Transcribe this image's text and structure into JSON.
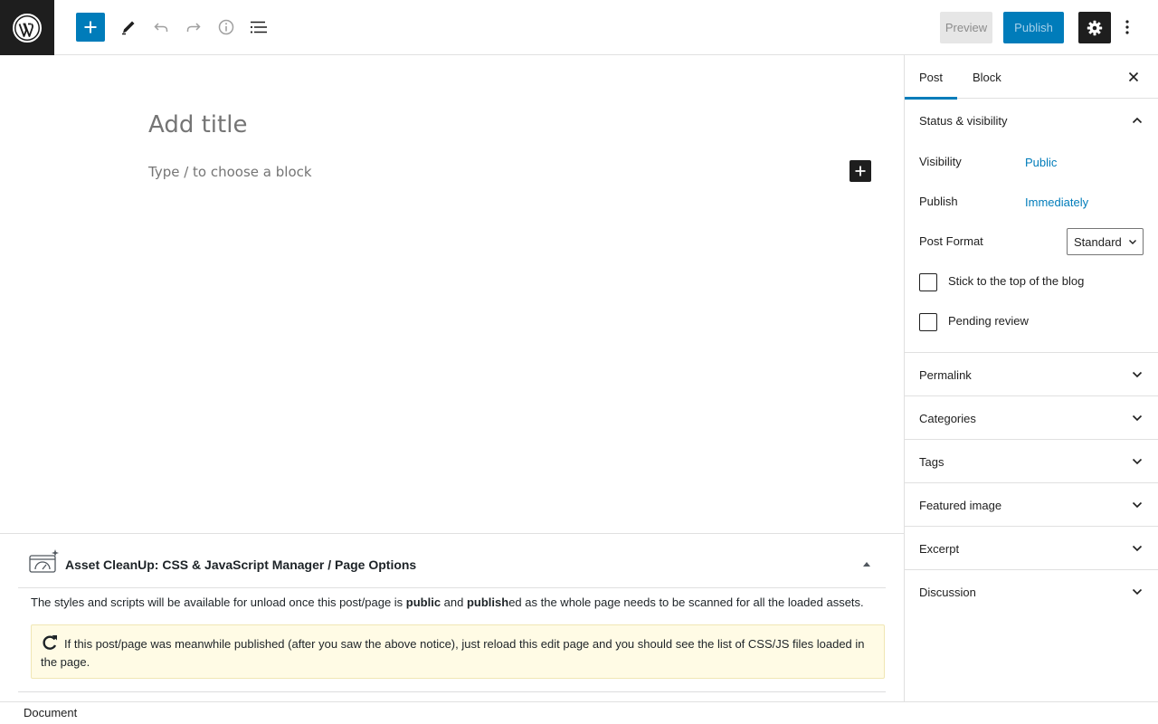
{
  "toolbar": {
    "preview_label": "Preview",
    "publish_label": "Publish",
    "icons": [
      "wordpress-logo",
      "plus-icon",
      "pencil-icon",
      "undo-icon",
      "redo-icon",
      "info-icon",
      "list-view-icon",
      "gear-icon",
      "more-vertical-icon"
    ]
  },
  "editor": {
    "title_placeholder": "Add title",
    "block_placeholder": "Type / to choose a block"
  },
  "metabox": {
    "title": "Asset CleanUp: CSS & JavaScript Manager / Page Options",
    "text_1": "The styles and scripts will be available for unload once this post/page is ",
    "text_bold_1": "public",
    "text_2": " and ",
    "text_bold_2": "publish",
    "text_3": "ed as the whole page needs to be scanned for all the loaded assets.",
    "notice": "If this post/page was meanwhile published (after you saw the above notice), just reload this edit page and you should see the list of CSS/JS files loaded in the page."
  },
  "footer": {
    "breadcrumb": "Document"
  },
  "sidebar": {
    "tabs": [
      {
        "label": "Post",
        "active": true
      },
      {
        "label": "Block",
        "active": false
      }
    ],
    "status_visibility": {
      "title": "Status & visibility",
      "visibility_label": "Visibility",
      "visibility_value": "Public",
      "publish_label": "Publish",
      "publish_value": "Immediately",
      "post_format_label": "Post Format",
      "post_format_value": "Standard",
      "sticky_label": "Stick to the top of the blog",
      "pending_label": "Pending review"
    },
    "panels": [
      {
        "title": "Permalink"
      },
      {
        "title": "Categories"
      },
      {
        "title": "Tags"
      },
      {
        "title": "Featured image"
      },
      {
        "title": "Excerpt"
      },
      {
        "title": "Discussion"
      }
    ]
  },
  "colors": {
    "accent": "#007cba",
    "dark": "#1e1e1e",
    "notice_bg": "#fffbe5"
  }
}
